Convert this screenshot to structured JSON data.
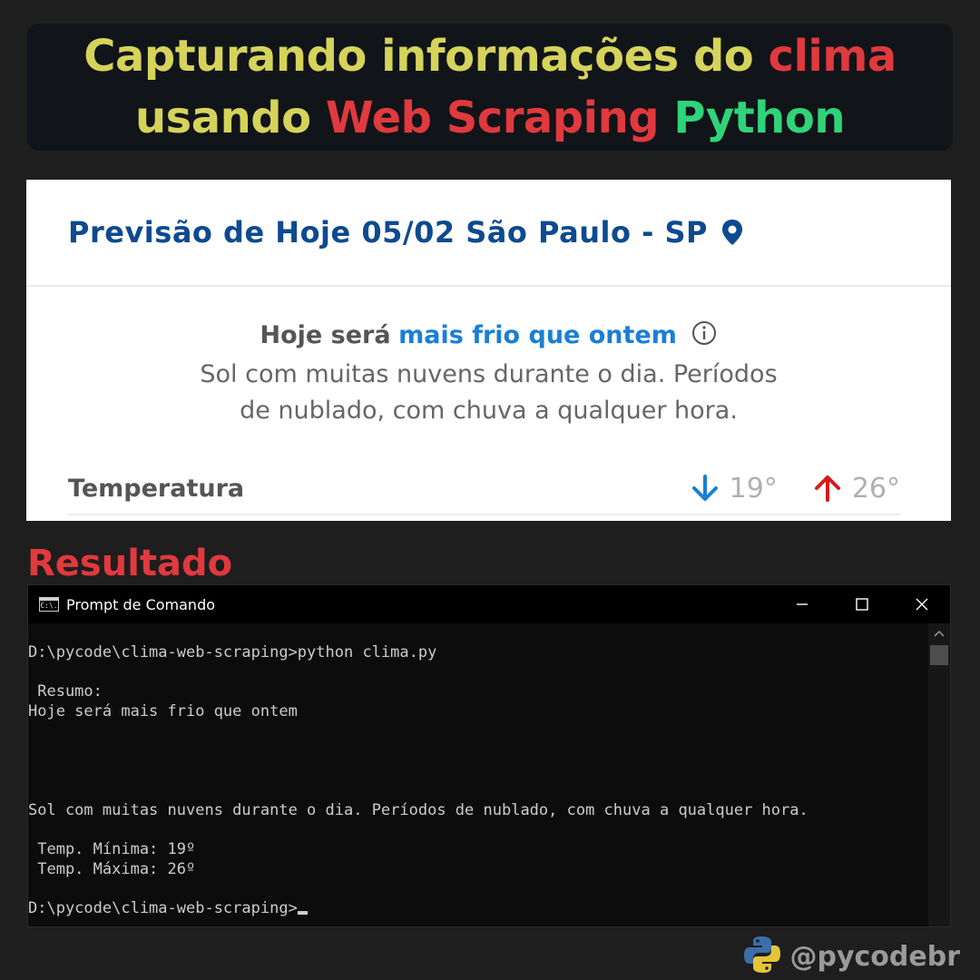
{
  "banner": {
    "line1": [
      {
        "text": "Capturando informações do ",
        "color": "#d5d35a"
      },
      {
        "text": "clima",
        "color": "#e0393e"
      }
    ],
    "line2": [
      {
        "text": "usando ",
        "color": "#d5d35a"
      },
      {
        "text": "Web Scraping ",
        "color": "#e0393e"
      },
      {
        "text": "Python",
        "color": "#2fd47a"
      }
    ]
  },
  "forecast": {
    "title": "Previsão de Hoje 05/02 São Paulo - SP",
    "summary_lead": "Hoje será",
    "summary_highlight": "mais frio que ontem",
    "description_line1": "Sol com muitas nuvens durante o dia. Períodos",
    "description_line2": "de nublado, com chuva a qualquer hora.",
    "temp_label": "Temperatura",
    "temp_min": "19°",
    "temp_max": "26°",
    "colors": {
      "title": "#0d4a8f",
      "highlight": "#1a7fd4",
      "arrow_down": "#1a7fd4",
      "arrow_up": "#d41a1a"
    }
  },
  "result_label": "Resultado",
  "cmd": {
    "title": "Prompt de Comando",
    "icon_text": "C:\\.",
    "lines": [
      "D:\\pycode\\clima-web-scraping>python clima.py",
      "",
      " Resumo:",
      "Hoje será mais frio que ontem",
      "",
      "",
      "",
      "",
      "Sol com muitas nuvens durante o dia. Períodos de nublado, com chuva a qualquer hora.",
      "",
      " Temp. Mínima: 19º",
      " Temp. Máxima: 26º",
      ""
    ],
    "prompt": "D:\\pycode\\clima-web-scraping>"
  },
  "footer": {
    "handle": "@pycodebr"
  }
}
